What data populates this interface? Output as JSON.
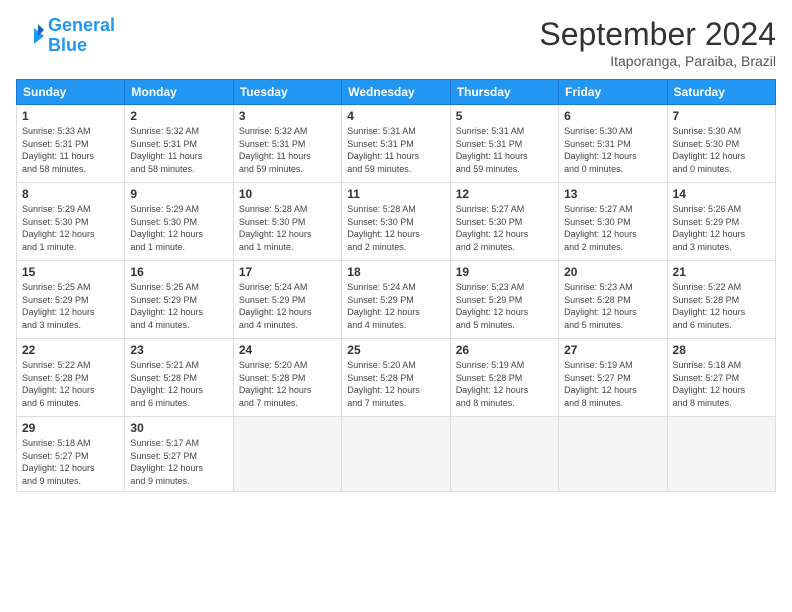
{
  "header": {
    "logo_line1": "General",
    "logo_line2": "Blue",
    "month": "September 2024",
    "location": "Itaporanga, Paraiba, Brazil"
  },
  "days_of_week": [
    "Sunday",
    "Monday",
    "Tuesday",
    "Wednesday",
    "Thursday",
    "Friday",
    "Saturday"
  ],
  "weeks": [
    [
      {
        "num": "1",
        "info": "Sunrise: 5:33 AM\nSunset: 5:31 PM\nDaylight: 11 hours\nand 58 minutes."
      },
      {
        "num": "2",
        "info": "Sunrise: 5:32 AM\nSunset: 5:31 PM\nDaylight: 11 hours\nand 58 minutes."
      },
      {
        "num": "3",
        "info": "Sunrise: 5:32 AM\nSunset: 5:31 PM\nDaylight: 11 hours\nand 59 minutes."
      },
      {
        "num": "4",
        "info": "Sunrise: 5:31 AM\nSunset: 5:31 PM\nDaylight: 11 hours\nand 59 minutes."
      },
      {
        "num": "5",
        "info": "Sunrise: 5:31 AM\nSunset: 5:31 PM\nDaylight: 11 hours\nand 59 minutes."
      },
      {
        "num": "6",
        "info": "Sunrise: 5:30 AM\nSunset: 5:31 PM\nDaylight: 12 hours\nand 0 minutes."
      },
      {
        "num": "7",
        "info": "Sunrise: 5:30 AM\nSunset: 5:30 PM\nDaylight: 12 hours\nand 0 minutes."
      }
    ],
    [
      {
        "num": "8",
        "info": "Sunrise: 5:29 AM\nSunset: 5:30 PM\nDaylight: 12 hours\nand 1 minute."
      },
      {
        "num": "9",
        "info": "Sunrise: 5:29 AM\nSunset: 5:30 PM\nDaylight: 12 hours\nand 1 minute."
      },
      {
        "num": "10",
        "info": "Sunrise: 5:28 AM\nSunset: 5:30 PM\nDaylight: 12 hours\nand 1 minute."
      },
      {
        "num": "11",
        "info": "Sunrise: 5:28 AM\nSunset: 5:30 PM\nDaylight: 12 hours\nand 2 minutes."
      },
      {
        "num": "12",
        "info": "Sunrise: 5:27 AM\nSunset: 5:30 PM\nDaylight: 12 hours\nand 2 minutes."
      },
      {
        "num": "13",
        "info": "Sunrise: 5:27 AM\nSunset: 5:30 PM\nDaylight: 12 hours\nand 2 minutes."
      },
      {
        "num": "14",
        "info": "Sunrise: 5:26 AM\nSunset: 5:29 PM\nDaylight: 12 hours\nand 3 minutes."
      }
    ],
    [
      {
        "num": "15",
        "info": "Sunrise: 5:25 AM\nSunset: 5:29 PM\nDaylight: 12 hours\nand 3 minutes."
      },
      {
        "num": "16",
        "info": "Sunrise: 5:25 AM\nSunset: 5:29 PM\nDaylight: 12 hours\nand 4 minutes."
      },
      {
        "num": "17",
        "info": "Sunrise: 5:24 AM\nSunset: 5:29 PM\nDaylight: 12 hours\nand 4 minutes."
      },
      {
        "num": "18",
        "info": "Sunrise: 5:24 AM\nSunset: 5:29 PM\nDaylight: 12 hours\nand 4 minutes."
      },
      {
        "num": "19",
        "info": "Sunrise: 5:23 AM\nSunset: 5:29 PM\nDaylight: 12 hours\nand 5 minutes."
      },
      {
        "num": "20",
        "info": "Sunrise: 5:23 AM\nSunset: 5:28 PM\nDaylight: 12 hours\nand 5 minutes."
      },
      {
        "num": "21",
        "info": "Sunrise: 5:22 AM\nSunset: 5:28 PM\nDaylight: 12 hours\nand 6 minutes."
      }
    ],
    [
      {
        "num": "22",
        "info": "Sunrise: 5:22 AM\nSunset: 5:28 PM\nDaylight: 12 hours\nand 6 minutes."
      },
      {
        "num": "23",
        "info": "Sunrise: 5:21 AM\nSunset: 5:28 PM\nDaylight: 12 hours\nand 6 minutes."
      },
      {
        "num": "24",
        "info": "Sunrise: 5:20 AM\nSunset: 5:28 PM\nDaylight: 12 hours\nand 7 minutes."
      },
      {
        "num": "25",
        "info": "Sunrise: 5:20 AM\nSunset: 5:28 PM\nDaylight: 12 hours\nand 7 minutes."
      },
      {
        "num": "26",
        "info": "Sunrise: 5:19 AM\nSunset: 5:28 PM\nDaylight: 12 hours\nand 8 minutes."
      },
      {
        "num": "27",
        "info": "Sunrise: 5:19 AM\nSunset: 5:27 PM\nDaylight: 12 hours\nand 8 minutes."
      },
      {
        "num": "28",
        "info": "Sunrise: 5:18 AM\nSunset: 5:27 PM\nDaylight: 12 hours\nand 8 minutes."
      }
    ],
    [
      {
        "num": "29",
        "info": "Sunrise: 5:18 AM\nSunset: 5:27 PM\nDaylight: 12 hours\nand 9 minutes."
      },
      {
        "num": "30",
        "info": "Sunrise: 5:17 AM\nSunset: 5:27 PM\nDaylight: 12 hours\nand 9 minutes."
      },
      {
        "num": "",
        "info": ""
      },
      {
        "num": "",
        "info": ""
      },
      {
        "num": "",
        "info": ""
      },
      {
        "num": "",
        "info": ""
      },
      {
        "num": "",
        "info": ""
      }
    ]
  ]
}
